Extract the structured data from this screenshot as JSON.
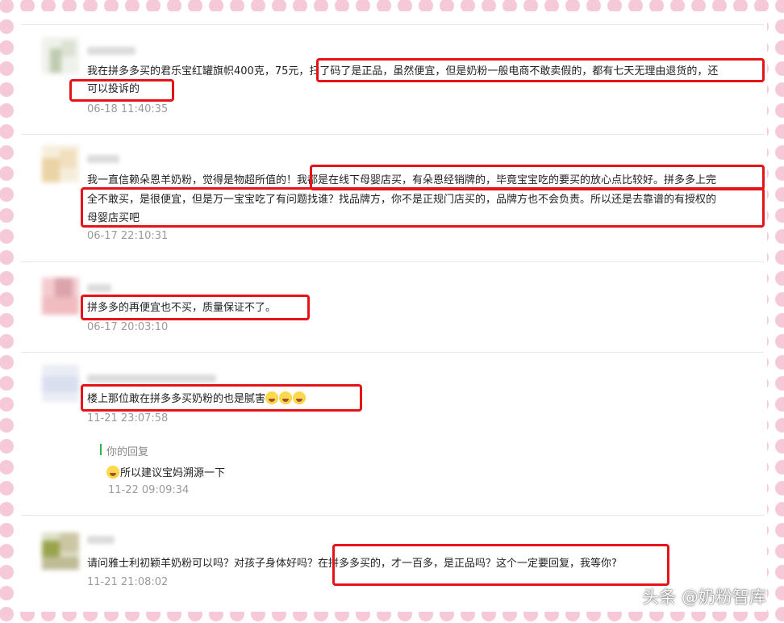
{
  "comments": [
    {
      "text": "我在拼多多买的君乐宝红罐旗帜400克，75元，扫了码了是正品，虽然便宜，但是奶粉一般电商不敢卖假的，都有七天无理由退货的，还",
      "text2": "可以投诉的",
      "time": "06-18 11:40:35"
    },
    {
      "text": "我一直信赖朵恩羊奶粉，觉得是物超所值的！我都是在线下母婴店买，有朵恩经销牌的，毕竟宝宝吃的要买的放心点比较好。拼多多上完",
      "text2": "全不敢买，是很便宜，但是万一宝宝吃了有问题找谁？找品牌方，你不是正规门店买的，品牌方也不会负责。所以还是去靠谱的有授权的",
      "text3": "母婴店买吧",
      "time": "06-17 22:10:31"
    },
    {
      "text": "拼多多的再便宜也不买，质量保证不了。",
      "time": "06-17 20:03:10"
    },
    {
      "text": "楼上那位敢在拼多多买奶粉的也是腻害",
      "time": "11-21 23:07:58",
      "reply": {
        "label": "你的回复",
        "text": "所以建议宝妈溯源一下",
        "time": "11-22 09:09:34"
      }
    },
    {
      "text": "请问雅士利初颖羊奶粉可以吗？对孩子身体好吗？在拼多多买的，才一百多，是正品吗？这个一定要回复，我等你?",
      "time": "11-21 21:08:02"
    }
  ],
  "watermark": "头条 @奶粉智库",
  "colors": {
    "highlight": "#e5141b",
    "timestamp": "#9a9a9a",
    "reply_bar": "#2db84d",
    "polka_dot": "#f6c9d8"
  },
  "icons": [
    "laughing-tears-emoji"
  ]
}
